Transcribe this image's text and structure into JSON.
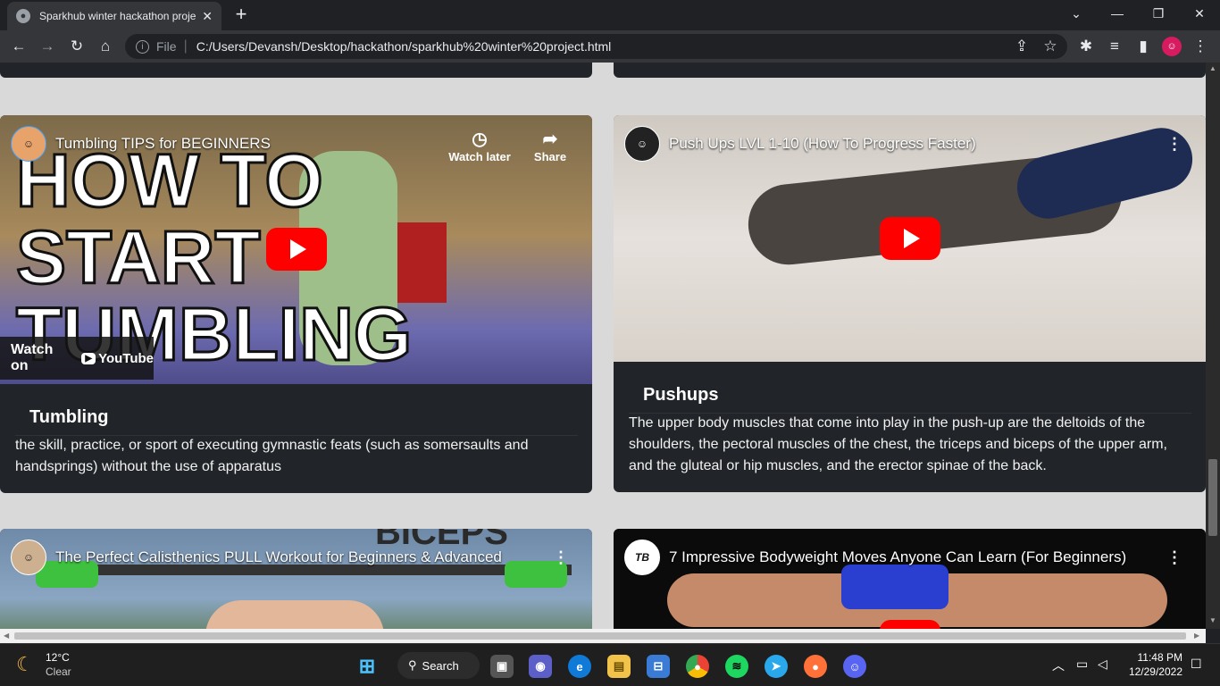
{
  "browser": {
    "tab_title": "Sparkhub winter hackathon proje",
    "url_scheme": "File",
    "url": "C:/Users/Devansh/Desktop/hackathon/sparkhub%20winter%20project.html"
  },
  "cards": [
    {
      "video_title": "Tumbling TIPS for BEGINNERS",
      "watch_later": "Watch later",
      "share": "Share",
      "watch_on": "Watch on",
      "youtube": "YouTube",
      "thumb_text": "HOW TO START TUMBLING",
      "title": "Tumbling",
      "text": "the skill, practice, or sport of executing gymnastic feats (such as somersaults and handsprings) without the use of apparatus"
    },
    {
      "video_title": "Push Ups LVL 1-10 (How To Progress Faster)",
      "title": "Pushups",
      "text": "The upper body muscles that come into play in the push-up are the deltoids of the shoulders, the pectoral muscles of the chest, the triceps and biceps of the upper arm, and the gluteal or hip muscles, and the erector spinae of the back."
    },
    {
      "video_title": "The Perfect Calisthenics PULL Workout for Beginners & Advanced",
      "thumb_text": "BICEPS"
    },
    {
      "video_title": "7 Impressive Bodyweight Moves Anyone Can Learn (For Beginners)",
      "channel_badge": "TB"
    }
  ],
  "taskbar": {
    "temp": "12°C",
    "weather": "Clear",
    "search": "Search",
    "time": "11:48 PM",
    "date": "12/29/2022"
  }
}
